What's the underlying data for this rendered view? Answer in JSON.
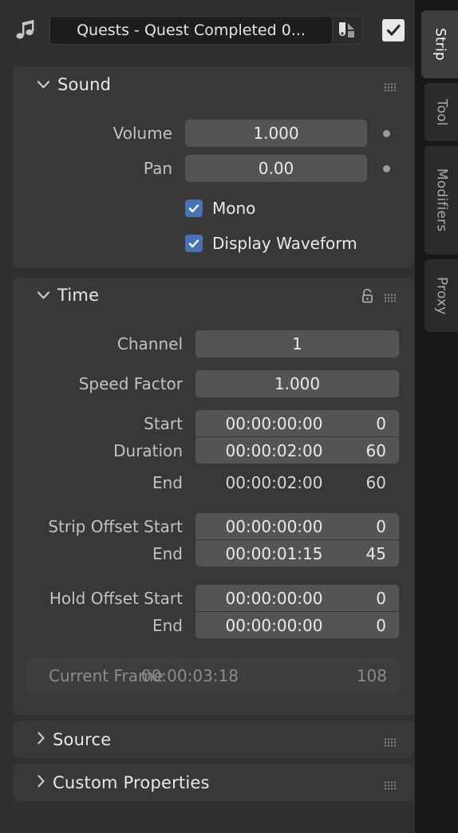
{
  "header": {
    "icon": "music-note-icon",
    "datablock_name": "Quests - Quest Completed 0...",
    "duplicate_icon": "duplicate-datablock-icon",
    "fake_user_checked": true,
    "fake_user_icon": "check-icon"
  },
  "tabs": [
    {
      "label": "Strip",
      "active": true
    },
    {
      "label": "Tool",
      "active": false
    },
    {
      "label": "Modifiers",
      "active": false
    },
    {
      "label": "Proxy",
      "active": false
    }
  ],
  "panels": {
    "sound": {
      "title": "Sound",
      "expanded": true,
      "chevron_icon": "chevron-down-icon",
      "grip_icon": "grip-dots-icon",
      "rows": [
        {
          "label": "Volume",
          "value": "1.000",
          "decorator": "animate-dot-icon"
        },
        {
          "label": "Pan",
          "value": "0.00",
          "decorator": "animate-dot-icon"
        }
      ],
      "checkboxes": [
        {
          "label": "Mono",
          "checked": true
        },
        {
          "label": "Display Waveform",
          "checked": true
        }
      ]
    },
    "time": {
      "title": "Time",
      "expanded": true,
      "chevron_icon": "chevron-down-icon",
      "lock_icon": "unlocked-padlock-icon",
      "grip_icon": "grip-dots-icon",
      "channel": {
        "label": "Channel",
        "value": "1"
      },
      "speed_factor": {
        "label": "Speed Factor",
        "value": "1.000"
      },
      "start": {
        "label": "Start",
        "timecode": "00:00:00:00",
        "frame": "0"
      },
      "duration": {
        "label": "Duration",
        "timecode": "00:00:02:00",
        "frame": "60"
      },
      "end": {
        "label": "End",
        "timecode": "00:00:02:00",
        "frame": "60"
      },
      "strip_offset_start": {
        "label": "Strip Offset Start",
        "timecode": "00:00:00:00",
        "frame": "0"
      },
      "strip_offset_end": {
        "label": "End",
        "timecode": "00:00:01:15",
        "frame": "45"
      },
      "hold_offset_start": {
        "label": "Hold Offset Start",
        "timecode": "00:00:00:00",
        "frame": "0"
      },
      "hold_offset_end": {
        "label": "End",
        "timecode": "00:00:00:00",
        "frame": "0"
      },
      "current_frame": {
        "label": "Current Frame",
        "timecode": "00:00:03:18",
        "frame": "108"
      }
    },
    "source": {
      "title": "Source",
      "expanded": false,
      "chevron_icon": "chevron-right-icon",
      "grip_icon": "grip-dots-icon"
    },
    "custom_properties": {
      "title": "Custom Properties",
      "expanded": false,
      "chevron_icon": "chevron-right-icon",
      "grip_icon": "grip-dots-icon"
    }
  },
  "colors": {
    "background": "#303030",
    "panel": "#383838",
    "field": "#545454",
    "checkbox_blue": "#4772b3",
    "tab_rail": "#181818",
    "tab_active": "#3d3d3d"
  }
}
